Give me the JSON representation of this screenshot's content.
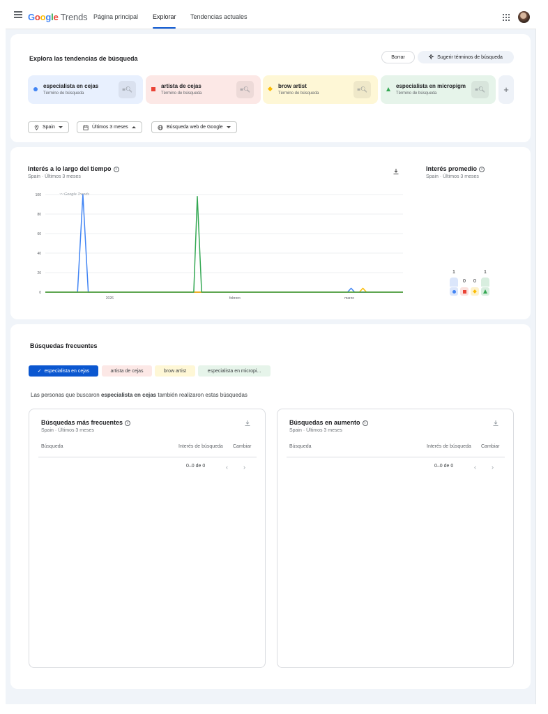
{
  "header": {
    "logo_brand": "Google",
    "logo_product": "Trends",
    "nav": [
      "Página principal",
      "Explorar",
      "Tendencias actuales"
    ],
    "active_nav": "Explorar"
  },
  "explore": {
    "title": "Explora las tendencias de búsqueda",
    "clear_label": "Borrar",
    "suggest_label": "Sugerir términos de búsqueda",
    "terms": [
      {
        "name": "especialista en cejas",
        "type": "Término de búsqueda",
        "color": "#4285f4",
        "bg": "#e8f0fe",
        "shape": "circle"
      },
      {
        "name": "artista de cejas",
        "type": "Término de búsqueda",
        "color": "#ea4335",
        "bg": "#fce8e6",
        "shape": "square"
      },
      {
        "name": "brow artist",
        "type": "Término de búsqueda",
        "color": "#fbbc04",
        "bg": "#fef7d6",
        "shape": "diamond"
      },
      {
        "name": "especialista en micropigm",
        "type": "Término de búsqueda",
        "color": "#34a853",
        "bg": "#e6f4ea",
        "shape": "triangle"
      }
    ],
    "add_label": "+",
    "filters": {
      "region": "Spain",
      "period": "Últimos 3 meses",
      "source": "Búsqueda web de Google"
    }
  },
  "interest": {
    "title": "Interés a lo largo del tiempo",
    "subtitle": "Spain · Últimos 3 meses",
    "watermark": "Google Trends",
    "avg_title": "Interés promedio",
    "avg_subtitle": "Spain · Últimos 3 meses"
  },
  "chart_data": {
    "type": "line",
    "x_tick_labels": [
      "2026",
      "febrero",
      "marzo"
    ],
    "y_ticks": [
      0,
      20,
      40,
      60,
      80,
      100
    ],
    "ylim": [
      0,
      100
    ],
    "grid": true,
    "x_range": [
      0,
      100
    ],
    "series": [
      {
        "name": "especialista en cejas",
        "color": "#4285f4",
        "points": [
          [
            0,
            0
          ],
          [
            9,
            0
          ],
          [
            10.5,
            100
          ],
          [
            12,
            0
          ],
          [
            84.5,
            0
          ],
          [
            85.5,
            4
          ],
          [
            86.5,
            0
          ],
          [
            100,
            0
          ]
        ]
      },
      {
        "name": "artista de cejas",
        "color": "#ea4335",
        "points": [
          [
            0,
            0
          ],
          [
            100,
            0
          ]
        ]
      },
      {
        "name": "brow artist",
        "color": "#fbbc04",
        "points": [
          [
            0,
            0
          ],
          [
            87.8,
            0
          ],
          [
            88.8,
            4
          ],
          [
            89.8,
            0
          ],
          [
            100,
            0
          ]
        ]
      },
      {
        "name": "especialista en micropigm",
        "color": "#34a853",
        "points": [
          [
            0,
            0
          ],
          [
            41.5,
            0
          ],
          [
            42.5,
            98
          ],
          [
            43.7,
            0
          ],
          [
            100,
            0
          ]
        ]
      }
    ],
    "averages": [
      {
        "name": "especialista en cejas",
        "value": 1,
        "color": "#4285f4",
        "bg": "#dbe6fb"
      },
      {
        "name": "artista de cejas",
        "value": 0,
        "color": "#ea4335",
        "bg": "#fbe1de"
      },
      {
        "name": "brow artist",
        "value": 0,
        "color": "#fbbc04",
        "bg": "#fdf2cc"
      },
      {
        "name": "especialista en micropigm",
        "value": 1,
        "color": "#34a853",
        "bg": "#d8eedf"
      }
    ]
  },
  "related": {
    "title": "Búsquedas frecuentes",
    "chips": [
      {
        "label": "especialista en cejas",
        "selected": true
      },
      {
        "label": "artista de cejas",
        "selected": false
      },
      {
        "label": "brow artist",
        "selected": false
      },
      {
        "label": "especialista en micropi...",
        "selected": false
      }
    ],
    "desc_prefix": "Las personas que buscaron ",
    "desc_term": "especialista en cejas",
    "desc_suffix": " también realizaron estas búsquedas",
    "top": {
      "title": "Búsquedas más frecuentes",
      "subtitle": "Spain · Últimos 3 meses",
      "col_query": "Búsqueda",
      "col_interest": "Interés de búsqueda",
      "col_change": "Cambiar",
      "pager": "0–0 de 0"
    },
    "rising": {
      "title": "Búsquedas en aumento",
      "subtitle": "Spain · Últimos 3 meses",
      "col_query": "Búsqueda",
      "col_interest": "Interés de búsqueda",
      "col_change": "Cambiar",
      "pager": "0–0 de 0"
    }
  }
}
